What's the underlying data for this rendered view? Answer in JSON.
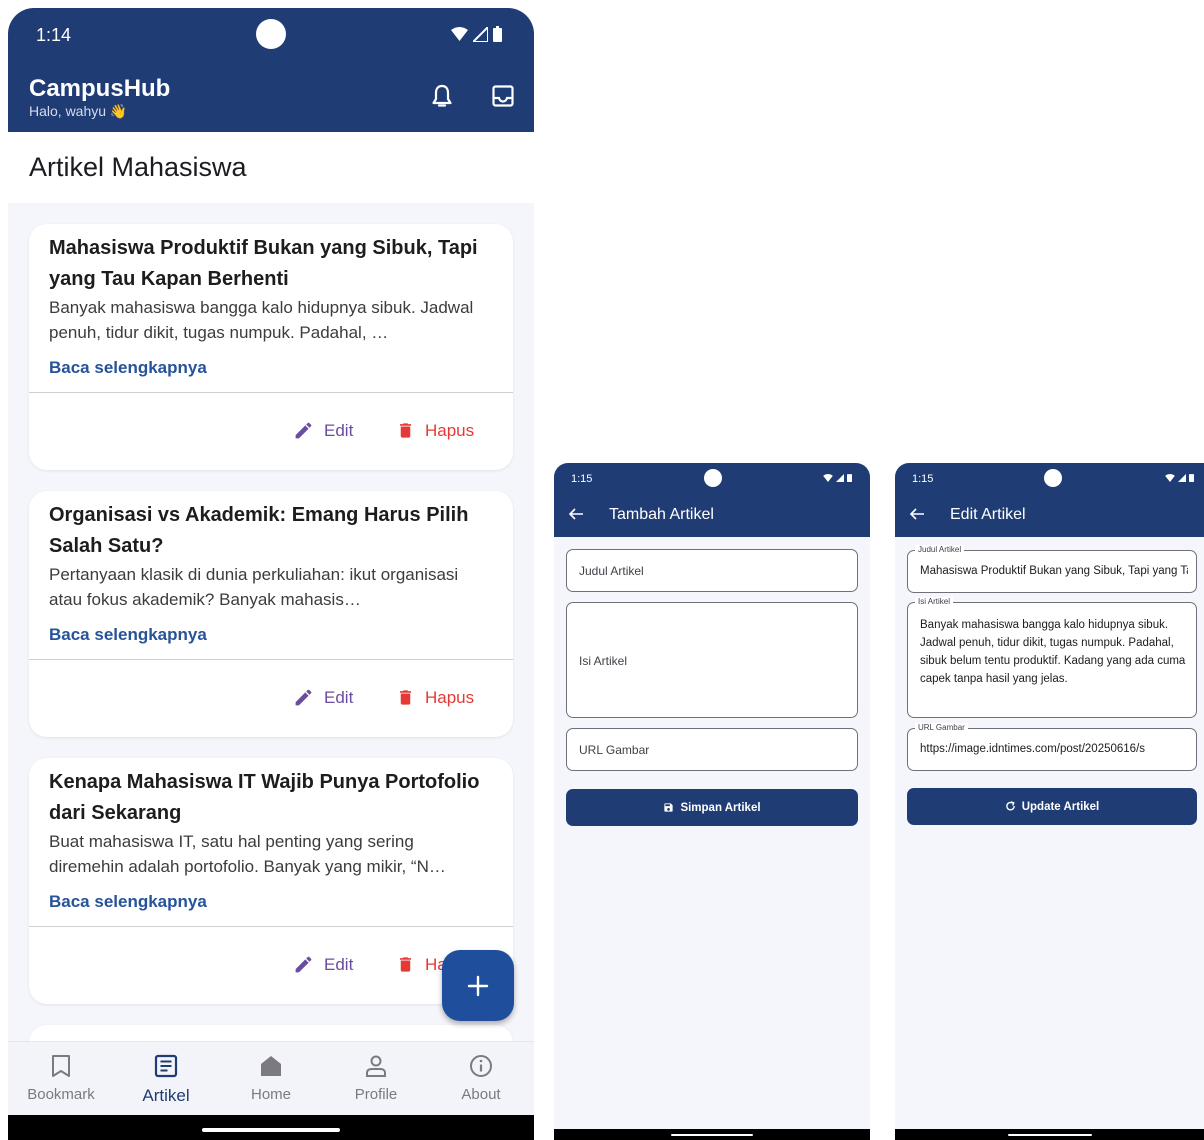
{
  "status_bar_main": {
    "time": "1:14"
  },
  "app_bar": {
    "title": "CampusHub",
    "greeting": "Halo, wahyu 👋"
  },
  "page": {
    "title": "Artikel Mahasiswa"
  },
  "articles": [
    {
      "title": "Mahasiswa Produktif Bukan yang Sibuk, Tapi yang Tau Kapan Berhenti",
      "excerpt": "Banyak mahasiswa bangga kalo hidupnya sibuk. Jadwal penuh, tidur dikit, tugas numpuk. Padahal, …",
      "read_more": "Baca selengkapnya",
      "edit_label": "Edit",
      "delete_label": "Hapus"
    },
    {
      "title": "Organisasi vs Akademik: Emang Harus Pilih Salah Satu?",
      "excerpt": "Pertanyaan klasik di dunia perkuliahan: ikut organisasi atau fokus akademik? Banyak mahasis…",
      "read_more": "Baca selengkapnya",
      "edit_label": "Edit",
      "delete_label": "Hapus"
    },
    {
      "title": "Kenapa Mahasiswa IT Wajib Punya Portofolio dari Sekarang",
      "excerpt": "Buat mahasiswa IT, satu hal penting yang sering diremehin adalah portofolio. Banyak yang mikir, “N…",
      "read_more": "Baca selengkapnya",
      "edit_label": "Edit",
      "delete_label": "Hapus"
    }
  ],
  "bottom_nav": [
    {
      "label": "Bookmark",
      "icon": "bookmark-icon",
      "active": false
    },
    {
      "label": "Artikel",
      "icon": "article-icon",
      "active": true
    },
    {
      "label": "Home",
      "icon": "home-icon",
      "active": false
    },
    {
      "label": "Profile",
      "icon": "profile-icon",
      "active": false
    },
    {
      "label": "About",
      "icon": "info-icon",
      "active": false
    }
  ],
  "add_screen": {
    "time": "1:15",
    "title": "Tambah Artikel",
    "title_placeholder": "Judul Artikel",
    "content_placeholder": "Isi Artikel",
    "url_placeholder": "URL Gambar",
    "save_button": "Simpan Artikel"
  },
  "edit_screen": {
    "time": "1:15",
    "title": "Edit Artikel",
    "title_label": "Judul Artikel",
    "title_value": "Mahasiswa Produktif Bukan yang Sibuk, Tapi yang Tau Kapan Berhenti",
    "content_label": "Isi Artikel",
    "content_value": "Banyak mahasiswa bangga kalo hidupnya sibuk. Jadwal penuh, tidur dikit, tugas numpuk. Padahal, sibuk belum tentu produktif. Kadang yang ada cuma capek tanpa hasil yang jelas.",
    "url_label": "URL Gambar",
    "url_value": "https://image.idntimes.com/post/20250616/s",
    "update_button": "Update Artikel"
  },
  "colors": {
    "primary": "#1f3c74",
    "fab": "#1f4f9c",
    "link": "#27539a",
    "edit": "#6a4ca0",
    "delete": "#e53935",
    "background": "#f5f6fb"
  }
}
